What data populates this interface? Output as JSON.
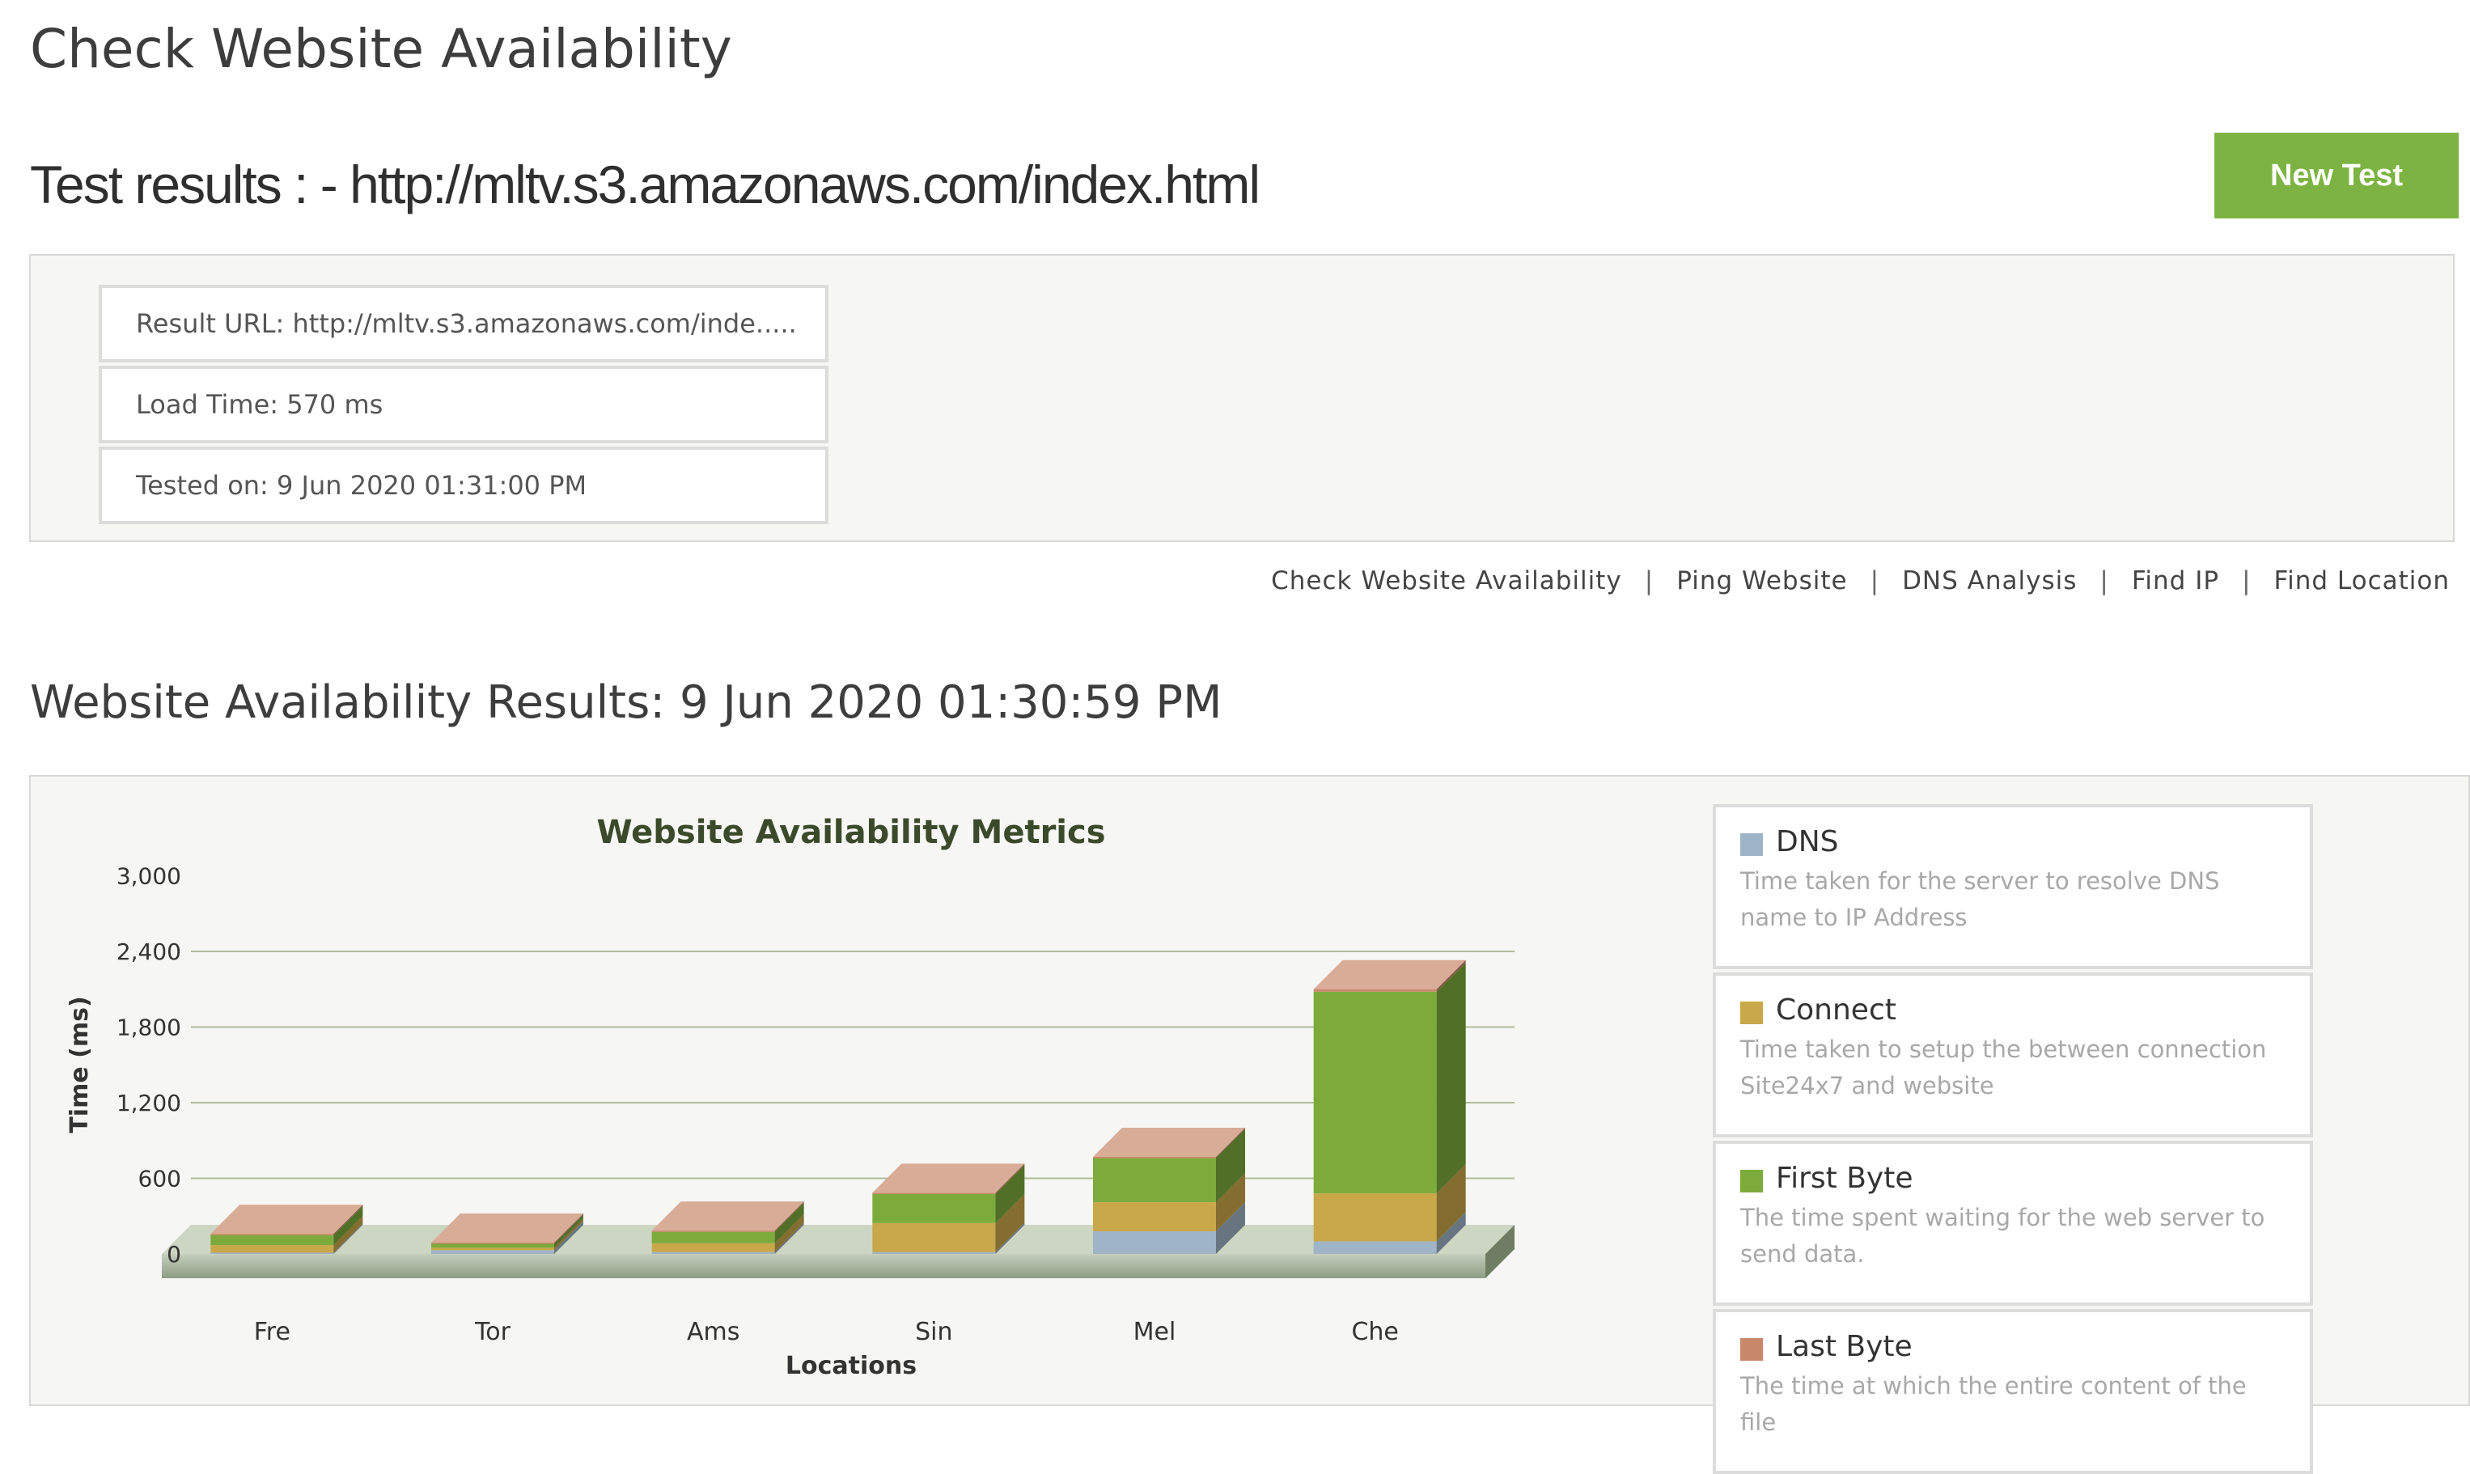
{
  "header": {
    "page_title": "Check Website Availability",
    "results_title": "Test results : - http://mltv.s3.amazonaws.com/index.html",
    "new_test_label": "New Test"
  },
  "summary": {
    "result_url": "Result URL: http://mltv.s3.amazonaws.com/inde.....",
    "load_time": "Load Time: 570 ms",
    "tested_on": "Tested on: 9 Jun 2020 01:31:00 PM"
  },
  "tool_links": [
    "Check Website Availability",
    "Ping Website",
    "DNS Analysis",
    "Find IP",
    "Find Location"
  ],
  "tool_link_separator": "|",
  "section_title": "Website Availability Results: 9 Jun 2020 01:30:59 PM",
  "legend": [
    {
      "name": "DNS",
      "color": "#9fb4c6",
      "desc": "Time taken for the server to resolve DNS name to IP Address"
    },
    {
      "name": "Connect",
      "color": "#c9a84a",
      "desc": "Time taken to setup the between connection Site24x7 and website"
    },
    {
      "name": "First Byte",
      "color": "#7cab3c",
      "desc": "The time spent waiting for the web server to send data."
    },
    {
      "name": "Last Byte",
      "color": "#c9886a",
      "desc": "The time at which the entire content of the file"
    }
  ],
  "chart_data": {
    "type": "bar",
    "stacked": true,
    "title": "Website Availability Metrics",
    "xlabel": "Locations",
    "ylabel": "Time (ms)",
    "ylim": [
      0,
      3000
    ],
    "yticks": [
      "3,000",
      "2,400",
      "1,800",
      "1,200",
      "600",
      "0"
    ],
    "grid": true,
    "categories": [
      "Fre",
      "Tor",
      "Ams",
      "Sin",
      "Mel",
      "Che"
    ],
    "series": [
      {
        "name": "DNS",
        "color": "#9fb4c6",
        "values": [
          10,
          30,
          15,
          15,
          180,
          100
        ]
      },
      {
        "name": "Connect",
        "color": "#c9a84a",
        "values": [
          60,
          20,
          70,
          230,
          230,
          380
        ]
      },
      {
        "name": "First Byte",
        "color": "#7cab3c",
        "values": [
          80,
          30,
          90,
          230,
          350,
          1600
        ]
      },
      {
        "name": "Last Byte",
        "color": "#c9886a",
        "values": [
          10,
          10,
          10,
          10,
          10,
          20
        ]
      }
    ]
  }
}
